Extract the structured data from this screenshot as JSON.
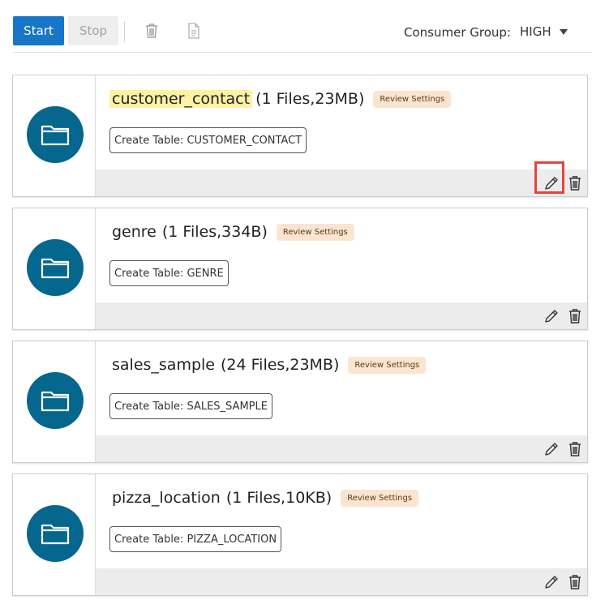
{
  "toolbar": {
    "start_label": "Start",
    "stop_label": "Stop",
    "icons": [
      "trash-icon",
      "document-icon"
    ],
    "consumer_group_label": "Consumer Group:",
    "consumer_group_value": "HIGH",
    "colors": {
      "start_bg": "#1776c8",
      "stop_bg": "#eeeeee"
    }
  },
  "cards": [
    {
      "name": "customer_contact",
      "meta": "(1 Files,23MB)",
      "review_label": "Review Settings",
      "create_table": "Create Table: CUSTOMER_CONTACT",
      "highlighted": true,
      "edit_focused": true
    },
    {
      "name": "genre",
      "meta": "(1 Files,334B)",
      "review_label": "Review Settings",
      "create_table": "Create Table: GENRE",
      "highlighted": false,
      "edit_focused": false
    },
    {
      "name": "sales_sample",
      "meta": "(24 Files,23MB)",
      "review_label": "Review Settings",
      "create_table": "Create Table: SALES_SAMPLE",
      "highlighted": false,
      "edit_focused": false
    },
    {
      "name": "pizza_location",
      "meta": "(1 Files,10KB)",
      "review_label": "Review Settings",
      "create_table": "Create Table: PIZZA_LOCATION",
      "highlighted": false,
      "edit_focused": false
    }
  ],
  "card_icons": {
    "folder": "folder-icon",
    "edit": "pencil-icon",
    "delete": "trash-icon"
  },
  "colors": {
    "folder_circle": "#05668e",
    "name_highlight": "#fbf2a3",
    "review_badge": "#fbe4d0",
    "focus_outline": "#e8443a",
    "footer": "#ececec"
  }
}
